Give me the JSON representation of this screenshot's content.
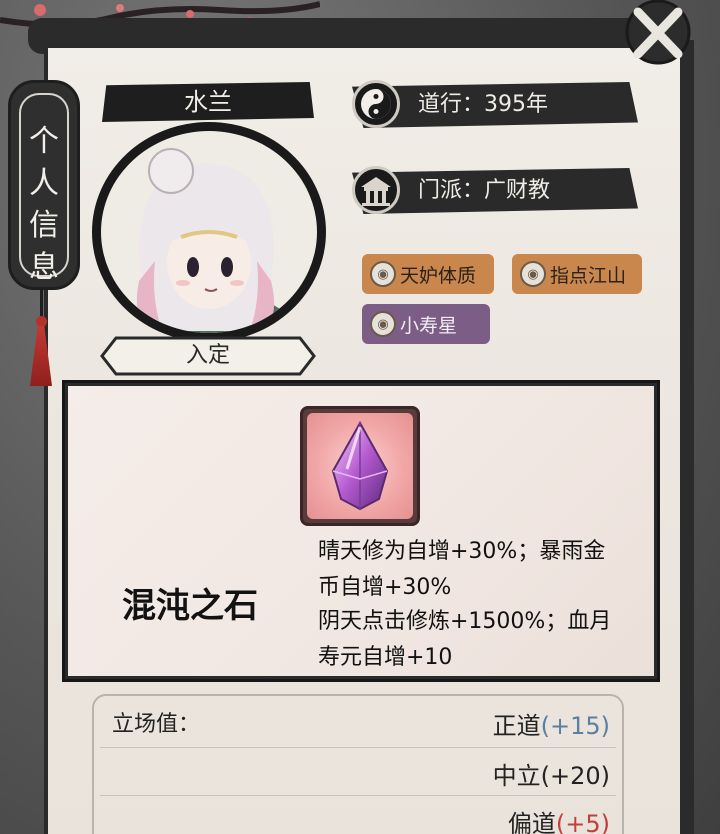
{
  "side_tab": {
    "label": "个人信息"
  },
  "character": {
    "name": "水兰",
    "status": "入定"
  },
  "info": {
    "cultivation": "道行：395年",
    "sect": "门派：广财教"
  },
  "traits": [
    {
      "label": "天妒体质",
      "color": "#c9874e"
    },
    {
      "label": "指点江山",
      "color": "#c9874e"
    },
    {
      "label": "小寿星",
      "color": "#7c5d86"
    }
  ],
  "item": {
    "name": "混沌之石",
    "desc_lines": [
      "晴天修为自增+30%；暴雨金",
      "币自增+30%",
      "阴天点击修炼+1500%；血月",
      "寿元自增+10"
    ]
  },
  "stance": {
    "label": "立场值：",
    "rows": [
      {
        "name": "正道",
        "delta": "(+15)",
        "tone": "blue"
      },
      {
        "name": "中立",
        "delta": "(+20)",
        "tone": "black"
      },
      {
        "name": "偏道",
        "delta": "(+5)",
        "tone": "red"
      }
    ]
  },
  "colors": {
    "delta_positive_blue": "#5b7fa0",
    "delta_positive_red": "#c0413a",
    "trait_orange": "#c9874e",
    "trait_purple": "#7c5d86"
  },
  "icons": {
    "close": "close-icon",
    "yin_yang": "yin-yang-icon",
    "sect": "sect-building-icon",
    "trait": "money-bag-icon",
    "crystal": "crystal-icon"
  }
}
